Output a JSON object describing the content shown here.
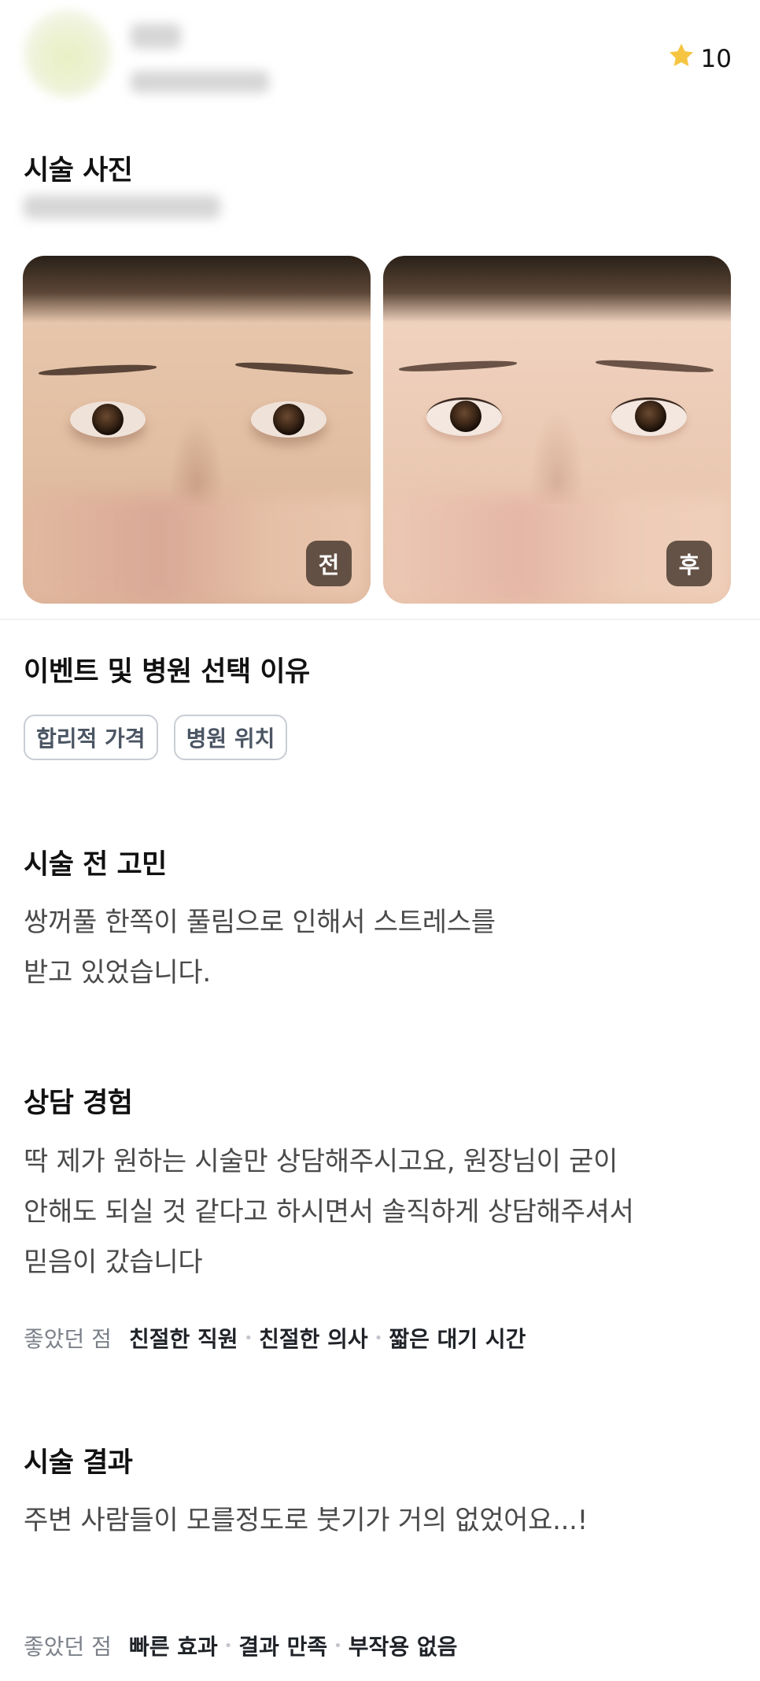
{
  "header": {
    "rating_value": "10",
    "rating_icon": "star-icon",
    "rating_color": "#f5c542"
  },
  "photos": {
    "title": "시술 사진",
    "before_label": "전",
    "after_label": "후"
  },
  "reason": {
    "title": "이벤트 및 병원 선택 이유",
    "chips": [
      "합리적 가격",
      "병원 위치"
    ]
  },
  "concern": {
    "title": "시술 전 고민",
    "lines": [
      "쌍꺼풀 한쪽이 풀림으로 인해서 스트레스를",
      "받고 있었습니다."
    ]
  },
  "consult": {
    "title": "상담 경험",
    "lines": [
      "딱 제가 원하는 시술만 상담해주시고요, 원장님이 굳이",
      "안해도 되실 것 같다고 하시면서 솔직하게 상담해주셔서",
      "믿음이 갔습니다"
    ],
    "likes_label": "좋았던 점",
    "likes": [
      "친절한 직원",
      "친절한 의사",
      "짧은 대기 시간"
    ]
  },
  "result": {
    "title": "시술 결과",
    "lines": [
      "주변 사람들이 모를정도로 붓기가 거의 없었어요...!"
    ],
    "likes_label": "좋았던 점",
    "likes": [
      "빠른 효과",
      "결과 만족",
      "부작용 없음"
    ]
  }
}
